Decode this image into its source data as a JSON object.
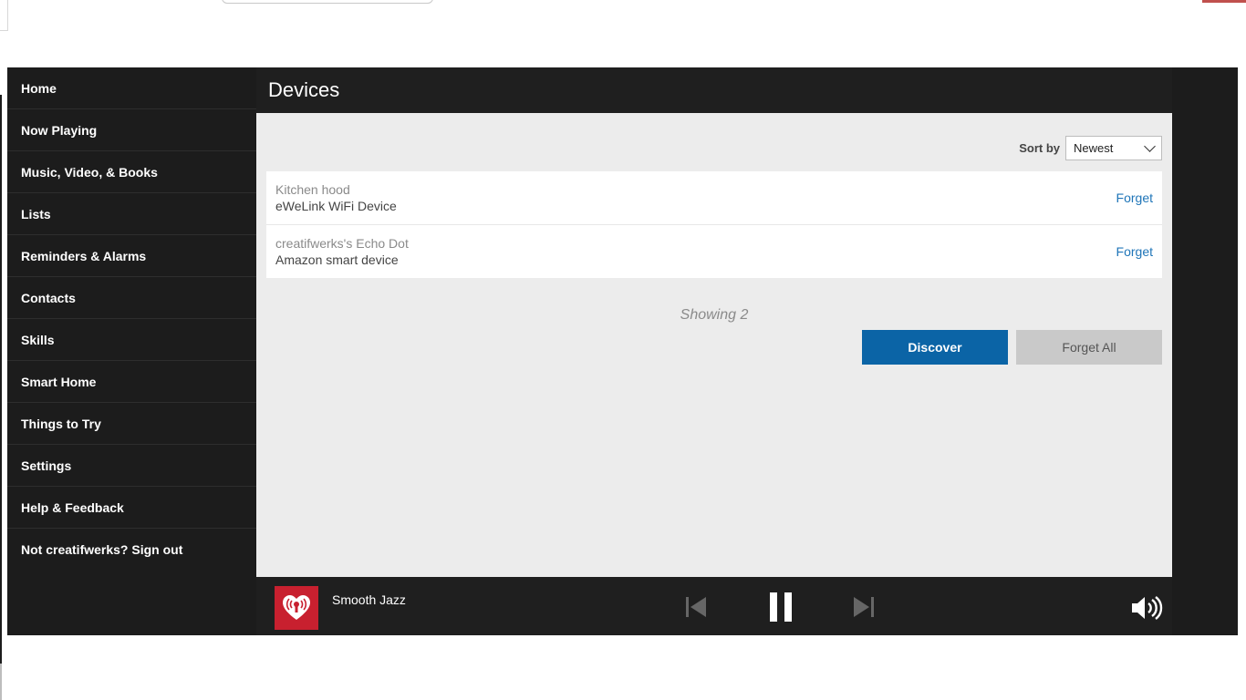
{
  "sidebar": {
    "items": [
      {
        "label": "Home"
      },
      {
        "label": "Now Playing"
      },
      {
        "label": "Music, Video, & Books"
      },
      {
        "label": "Lists"
      },
      {
        "label": "Reminders & Alarms"
      },
      {
        "label": "Contacts"
      },
      {
        "label": "Skills"
      },
      {
        "label": "Smart Home"
      },
      {
        "label": "Things to Try"
      },
      {
        "label": "Settings"
      },
      {
        "label": "Help & Feedback"
      },
      {
        "label": "Not creatifwerks? Sign out"
      }
    ]
  },
  "page": {
    "title": "Devices",
    "sort_label": "Sort by",
    "sort_value": "Newest"
  },
  "devices": [
    {
      "name": "Kitchen hood",
      "type": "eWeLink WiFi Device",
      "action": "Forget"
    },
    {
      "name": "creatifwerks's Echo Dot",
      "type": "Amazon smart device",
      "action": "Forget"
    }
  ],
  "showing_text": "Showing 2",
  "buttons": {
    "discover": "Discover",
    "forget_all": "Forget All"
  },
  "player": {
    "station": "Smooth Jazz",
    "station_logo_icon": "iheartradio-icon",
    "controls": [
      "previous-icon",
      "pause-icon",
      "next-icon",
      "volume-icon"
    ]
  },
  "colors": {
    "accent": "#0b64a6",
    "link": "#1f75b8",
    "station_logo_bg": "#c8202f",
    "dark_bg": "#1f1f1f",
    "panel_bg": "#ececec"
  }
}
